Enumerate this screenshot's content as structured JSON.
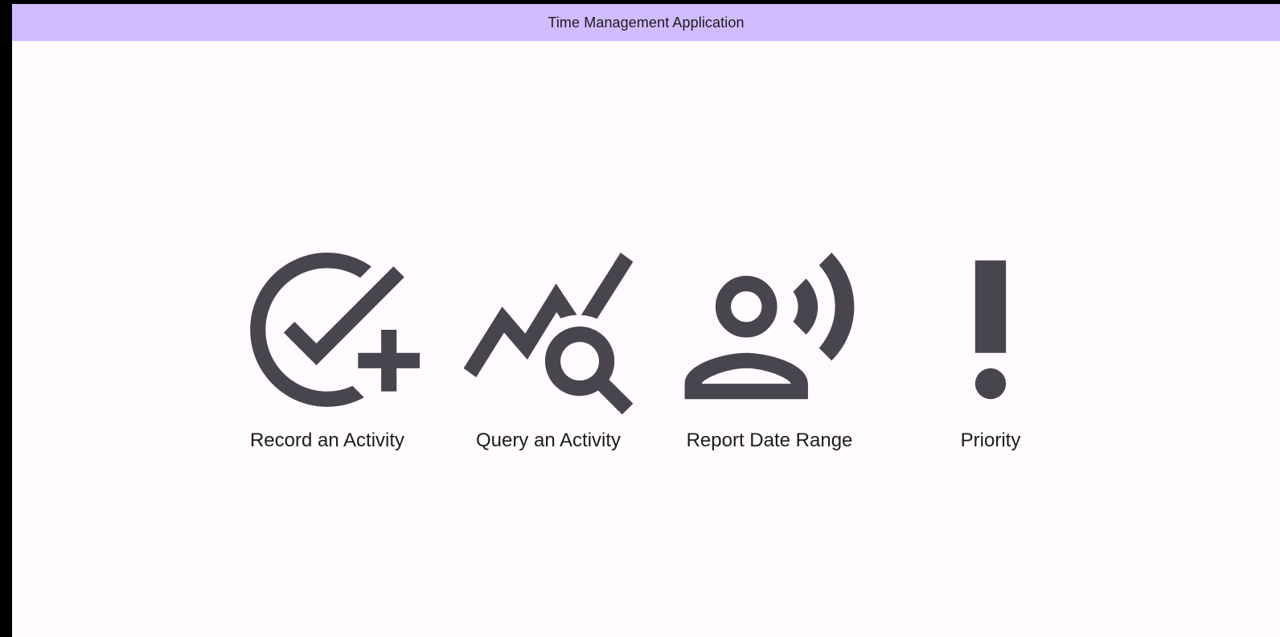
{
  "app_bar": {
    "title": "Time Management Application"
  },
  "menu": {
    "items": [
      {
        "label": "Record an Activity",
        "icon": "add-task-icon"
      },
      {
        "label": "Query an Activity",
        "icon": "query-stats-icon"
      },
      {
        "label": "Report Date Range",
        "icon": "record-voice-over-icon"
      },
      {
        "label": "Priority",
        "icon": "priority-high-icon"
      }
    ]
  },
  "colors": {
    "app_bar_background": "#d0bcff",
    "page_background": "#fffbfe",
    "icon": "#49454f",
    "text": "#1c1b1f"
  }
}
